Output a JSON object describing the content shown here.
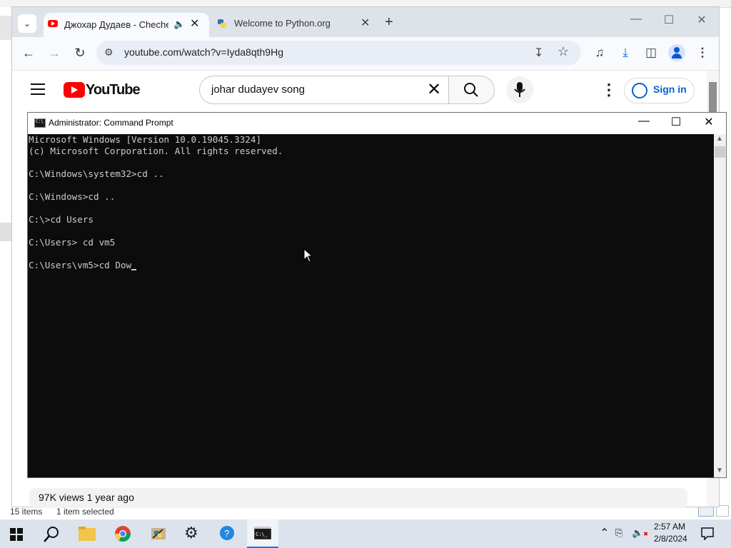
{
  "explorer": {
    "status_items": "15 items",
    "status_selected": "1 item selected"
  },
  "browser": {
    "tabs": [
      {
        "title": "Джохар Дудаев - Chechen",
        "active": true
      },
      {
        "title": "Welcome to Python.org",
        "active": false
      }
    ],
    "url": "youtube.com/watch?v=Iyda8qth9Hg"
  },
  "youtube": {
    "logo_text": "YouTube",
    "search_query": "johar dudayev song",
    "sign_in_label": "Sign in",
    "views_text": "97K views  1 year ago"
  },
  "cmd": {
    "title": "Administrator: Command Prompt",
    "lines": [
      "Microsoft Windows [Version 10.0.19045.3324]",
      "(c) Microsoft Corporation. All rights reserved.",
      "",
      "C:\\Windows\\system32>cd ..",
      "",
      "C:\\Windows>cd ..",
      "",
      "C:\\>cd Users",
      "",
      "C:\\Users> cd vm5",
      "",
      "C:\\Users\\vm5>cd Dow"
    ]
  },
  "taskbar": {
    "apps": [
      "start-icon",
      "search-icon",
      "file-explorer-icon",
      "chrome-icon",
      "python-idle-icon",
      "settings-icon",
      "help-icon",
      "command-prompt-icon"
    ],
    "time": "2:57 AM",
    "date": "2/8/2024"
  }
}
